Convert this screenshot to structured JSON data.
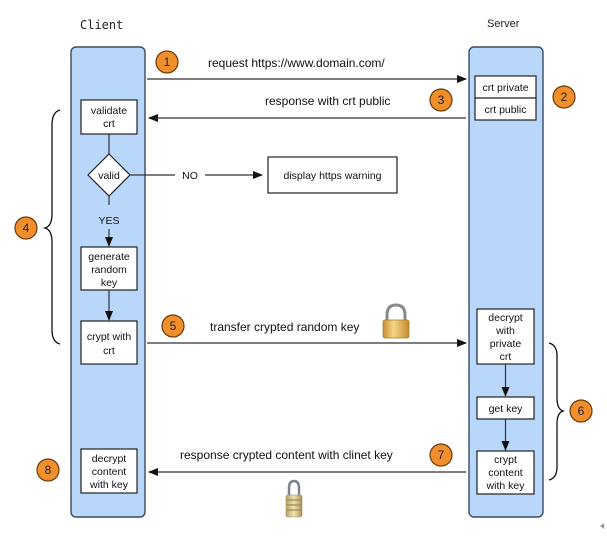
{
  "lanes": {
    "client": "Client",
    "server": "Server"
  },
  "messages": {
    "m1": "request https://www.domain.com/",
    "m3": "response with crt public",
    "m5": "transfer crypted random key",
    "m7": "response crypted content with clinet key"
  },
  "client_boxes": {
    "validate": [
      "validate",
      "crt"
    ],
    "valid": "valid",
    "generate": [
      "generate",
      "random",
      "key"
    ],
    "crypt": [
      "crypt with",
      "crt"
    ],
    "decrypt": [
      "decrypt",
      "content",
      "with key"
    ]
  },
  "server_boxes": {
    "crt_private": "crt private",
    "crt_public": "crt public",
    "decrypt": [
      "decrypt",
      "with",
      "private",
      "crt"
    ],
    "get_key": "get key",
    "crypt": [
      "crypt",
      "content",
      "with key"
    ]
  },
  "branch": {
    "no": "NO",
    "yes": "YES",
    "warning": "display https warning"
  },
  "badges": [
    "1",
    "2",
    "3",
    "4",
    "5",
    "6",
    "7",
    "8"
  ],
  "colors": {
    "lane_fill": "#b9d6fb",
    "badge_fill": "#f08f2b",
    "lock_gold": "#e0b458"
  },
  "icons": [
    "padlock-icon",
    "combination-lock-icon"
  ]
}
